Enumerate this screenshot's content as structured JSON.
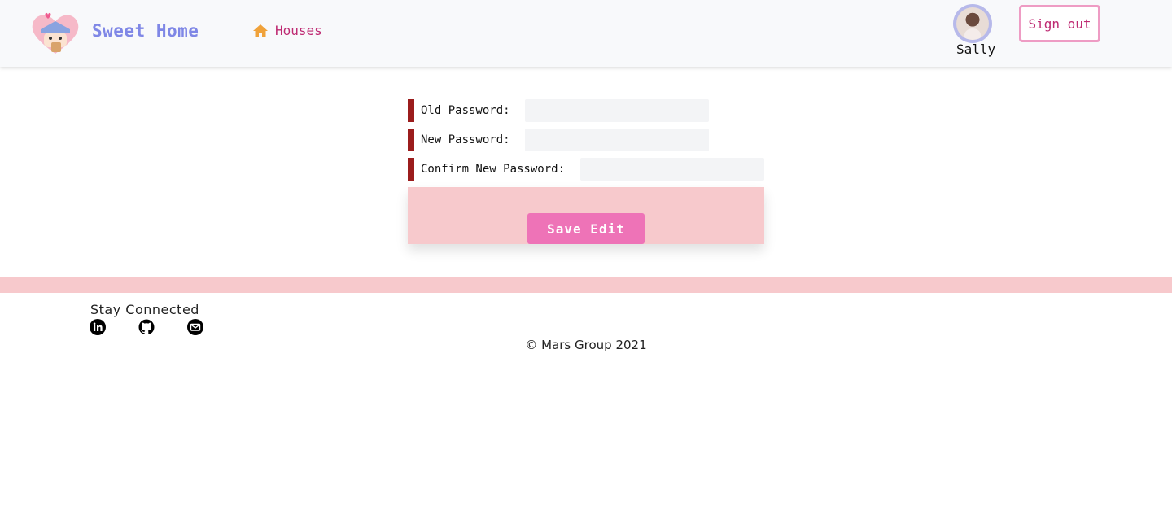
{
  "header": {
    "brand": "Sweet Home",
    "nav_houses": "Houses",
    "user_name": "Sally",
    "sign_out": "Sign out"
  },
  "form": {
    "fields": [
      {
        "label": "Old Password:",
        "value": ""
      },
      {
        "label": "New Password:",
        "value": ""
      },
      {
        "label": "Confirm New Password:",
        "value": ""
      }
    ],
    "save_label": "Save Edit"
  },
  "footer": {
    "stay_connected": "Stay Connected",
    "copyright": "© Mars Group 2021"
  },
  "colors": {
    "brand": "#7f87e6",
    "accent": "#be2a72",
    "panel": "#f7c9cc",
    "button": "#ee73b7",
    "bar": "#9b1c1c"
  },
  "icons": [
    "heart-house-logo",
    "home-icon",
    "linkedin-icon",
    "github-icon",
    "mail-icon"
  ]
}
